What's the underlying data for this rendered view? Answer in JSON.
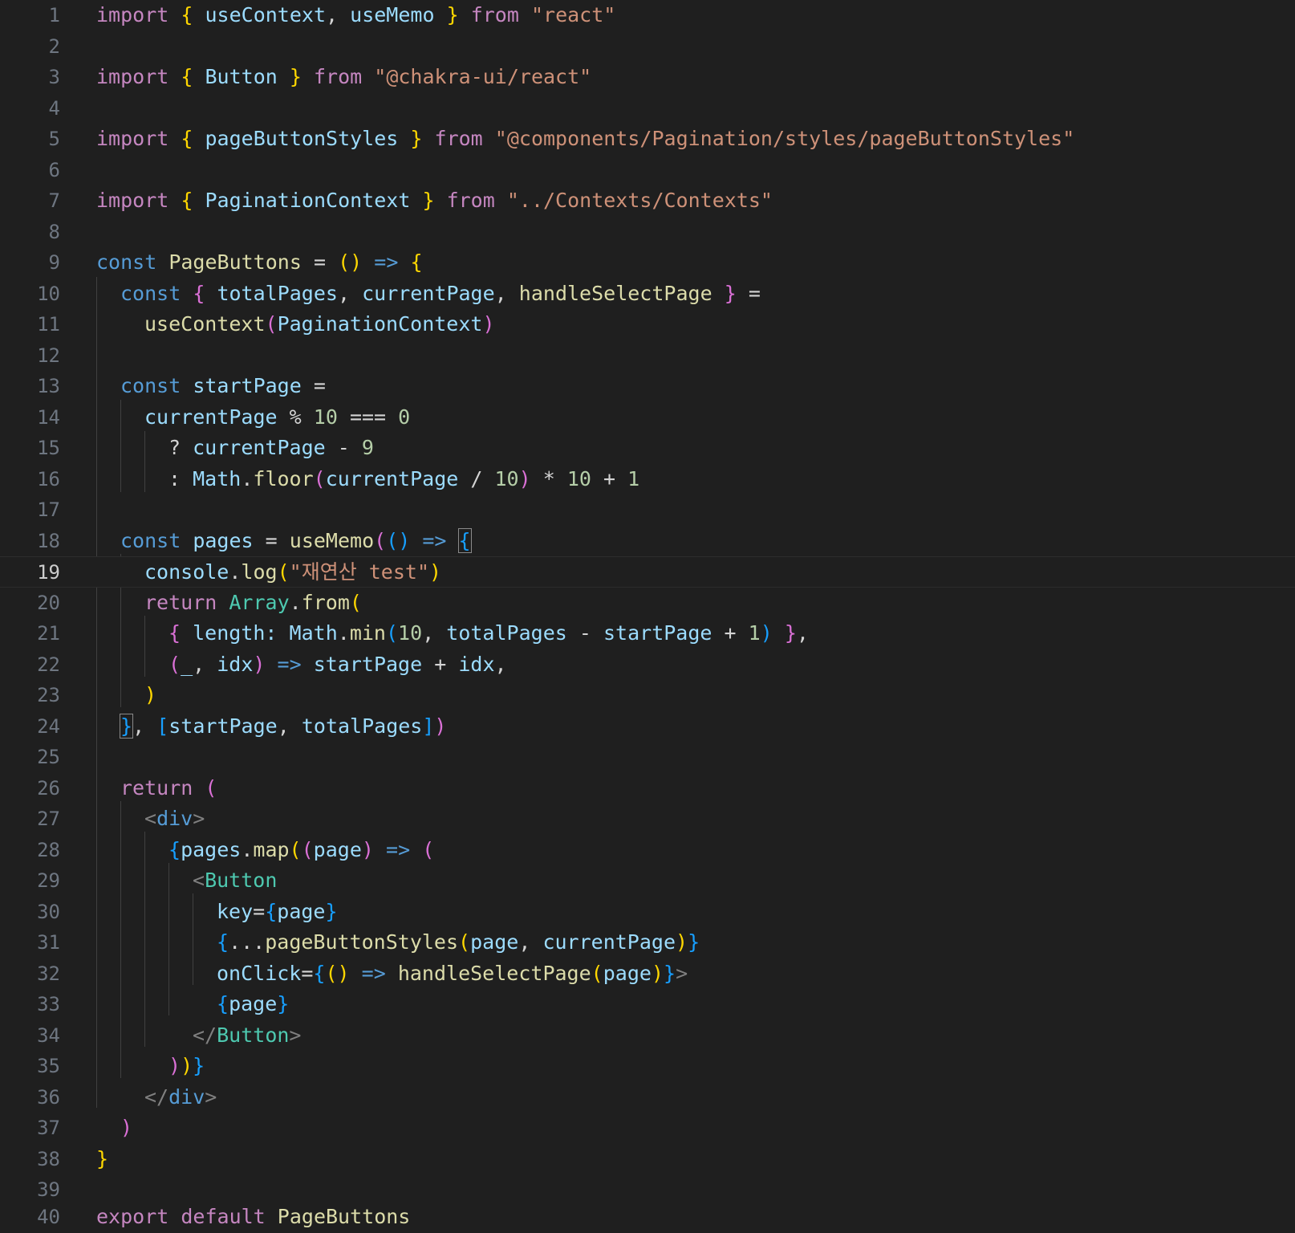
{
  "editor": {
    "language": "javascriptreact",
    "current_line": 19,
    "line_numbers": [
      "1",
      "2",
      "3",
      "4",
      "5",
      "6",
      "7",
      "8",
      "9",
      "10",
      "11",
      "12",
      "13",
      "14",
      "15",
      "16",
      "17",
      "18",
      "19",
      "20",
      "21",
      "22",
      "23",
      "24",
      "25",
      "26",
      "27",
      "28",
      "29",
      "30",
      "31",
      "32",
      "33",
      "34",
      "35",
      "36",
      "37",
      "38",
      "39",
      "40"
    ]
  },
  "code": {
    "l1": {
      "kw_import": "import",
      "b_open": "{",
      "name1": "useContext",
      "comma": ",",
      "name2": "useMemo",
      "b_close": "}",
      "kw_from": "from",
      "src": "\"react\""
    },
    "l3": {
      "kw_import": "import",
      "b_open": "{",
      "name1": "Button",
      "b_close": "}",
      "kw_from": "from",
      "src": "\"@chakra-ui/react\""
    },
    "l5": {
      "kw_import": "import",
      "b_open": "{",
      "name1": "pageButtonStyles",
      "b_close": "}",
      "kw_from": "from",
      "src": "\"@components/Pagination/styles/pageButtonStyles\""
    },
    "l7": {
      "kw_import": "import",
      "b_open": "{",
      "name1": "PaginationContext",
      "b_close": "}",
      "kw_from": "from",
      "src": "\"../Contexts/Contexts\""
    },
    "l9": {
      "kw_const": "const",
      "name": "PageButtons",
      "eq": "=",
      "parens": "()",
      "arrow": "=>",
      "brace": "{"
    },
    "l10": {
      "kw_const": "const",
      "b_open": "{",
      "v1": "totalPages",
      "c1": ",",
      "v2": "currentPage",
      "c2": ",",
      "v3": "handleSelectPage",
      "b_close": "}",
      "eq": "="
    },
    "l11": {
      "fn": "useContext",
      "p_open": "(",
      "arg": "PaginationContext",
      "p_close": ")"
    },
    "l13": {
      "kw_const": "const",
      "name": "startPage",
      "eq": "="
    },
    "l14": {
      "v": "currentPage",
      "op1": "%",
      "n1": "10",
      "op2": "===",
      "n2": "0"
    },
    "l15": {
      "q": "?",
      "v": "currentPage",
      "op": "-",
      "n": "9"
    },
    "l16": {
      "colon": ":",
      "obj": "Math",
      "dot": ".",
      "fn": "floor",
      "p_open": "(",
      "v": "currentPage",
      "op1": "/",
      "n1": "10",
      "p_close": ")",
      "op2": "*",
      "n2": "10",
      "op3": "+",
      "n3": "1"
    },
    "l18": {
      "kw_const": "const",
      "name": "pages",
      "eq": "=",
      "fn": "useMemo",
      "p_open": "(",
      "parens": "()",
      "arrow": "=>",
      "brace": "{"
    },
    "l19": {
      "obj": "console",
      "dot": ".",
      "fn": "log",
      "p_open": "(",
      "str": "\"재연산 test\"",
      "p_close": ")"
    },
    "l20": {
      "kw_return": "return",
      "cls": "Array",
      "dot": ".",
      "fn": "from",
      "p_open": "("
    },
    "l21": {
      "b_open": "{",
      "key": "length:",
      "obj": "Math",
      "dot": ".",
      "fn": "min",
      "p_open": "(",
      "n1": "10",
      "c": ",",
      "v1": "totalPages",
      "op1": "-",
      "v2": "startPage",
      "op2": "+",
      "n2": "1",
      "p_close": ")",
      "b_close": "}",
      "c2": ","
    },
    "l22": {
      "p_open": "(",
      "a1": "_",
      "c": ",",
      "a2": "idx",
      "p_close": ")",
      "arrow": "=>",
      "v1": "startPage",
      "op": "+",
      "v2": "idx",
      "c2": ","
    },
    "l23": {
      "p_close": ")"
    },
    "l24": {
      "brace": "}",
      "c": ",",
      "sq_open": "[",
      "v1": "startPage",
      "c2": ",",
      "v2": "totalPages",
      "sq_close": "]",
      "p_close": ")"
    },
    "l26": {
      "kw_return": "return",
      "p_open": "("
    },
    "l27": {
      "lt": "<",
      "tag": "div",
      "gt": ">"
    },
    "l28": {
      "b_open": "{",
      "v": "pages",
      "dot": ".",
      "fn": "map",
      "p_open": "(",
      "p_open2": "(",
      "arg": "page",
      "p_close2": ")",
      "arrow": "=>",
      "p_open3": "("
    },
    "l29": {
      "lt": "<",
      "tag": "Button"
    },
    "l30": {
      "attr": "key",
      "eq": "=",
      "b_open": "{",
      "v": "page",
      "b_close": "}"
    },
    "l31": {
      "b_open": "{",
      "spread": "...",
      "fn": "pageButtonStyles",
      "p_open": "(",
      "v1": "page",
      "c": ",",
      "v2": "currentPage",
      "p_close": ")",
      "b_close": "}"
    },
    "l32": {
      "attr": "onClick",
      "eq": "=",
      "b_open": "{",
      "parens": "()",
      "arrow": "=>",
      "fn": "handleSelectPage",
      "p_open": "(",
      "v": "page",
      "p_close": ")",
      "b_close": "}",
      "gt": ">"
    },
    "l33": {
      "b_open": "{",
      "v": "page",
      "b_close": "}"
    },
    "l34": {
      "lt": "</",
      "tag": "Button",
      "gt": ">"
    },
    "l35": {
      "p1": ")",
      "p2": ")",
      "b": "}"
    },
    "l36": {
      "lt": "</",
      "tag": "div",
      "gt": ">"
    },
    "l37": {
      "p_close": ")"
    },
    "l38": {
      "brace": "}"
    },
    "l40": {
      "kw_export": "export",
      "kw_default": "default",
      "name": "PageButtons"
    }
  },
  "colors": {
    "background": "#1f1f1f",
    "keyword_control": "#c586c0",
    "keyword_storage": "#569cd6",
    "string": "#ce9178",
    "variable": "#9cdcfe",
    "function": "#dcdcaa",
    "type": "#4ec9b0",
    "number": "#b5cea8",
    "bracket_1": "#ffd700",
    "bracket_2": "#da70d6",
    "bracket_3": "#179fff"
  }
}
